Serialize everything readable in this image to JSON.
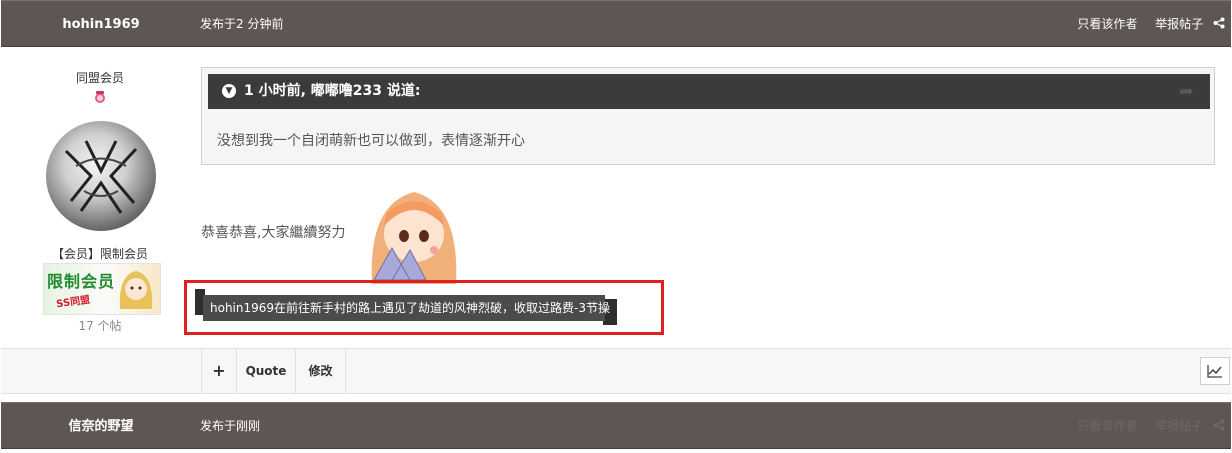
{
  "post": {
    "author": "hohin1969",
    "posted": "发布于2 分钟前",
    "actions": {
      "only_author": "只看该作者",
      "report": "举报帖子"
    }
  },
  "sidebar": {
    "group_title": "同盟会员",
    "member_label": "【会员】限制会员",
    "badge_text": "限制会员",
    "badge_sub": "SS同盟",
    "post_count": "17 个帖"
  },
  "quote": {
    "citation": "1 小时前, 嘟嘟噜233 说道:",
    "body": "没想到我一个自闭萌新也可以做到，表情逐渐开心"
  },
  "content": {
    "text": "恭喜恭喜,大家繼續努力",
    "notice": "hohin1969在前往新手村的路上遇见了劫道的风神烈破，收取过路费-3节操"
  },
  "toolbar": {
    "plus": "+",
    "quote": "Quote",
    "edit": "修改"
  },
  "next_post": {
    "author": "信奈的野望",
    "posted": "发布于刚刚",
    "actions": {
      "only_author": "只看该作者",
      "report": "举报帖子"
    }
  },
  "colors": {
    "header_bg": "#5e5653",
    "quote_head_bg": "#3b3b3b",
    "highlight": "#e02020"
  }
}
